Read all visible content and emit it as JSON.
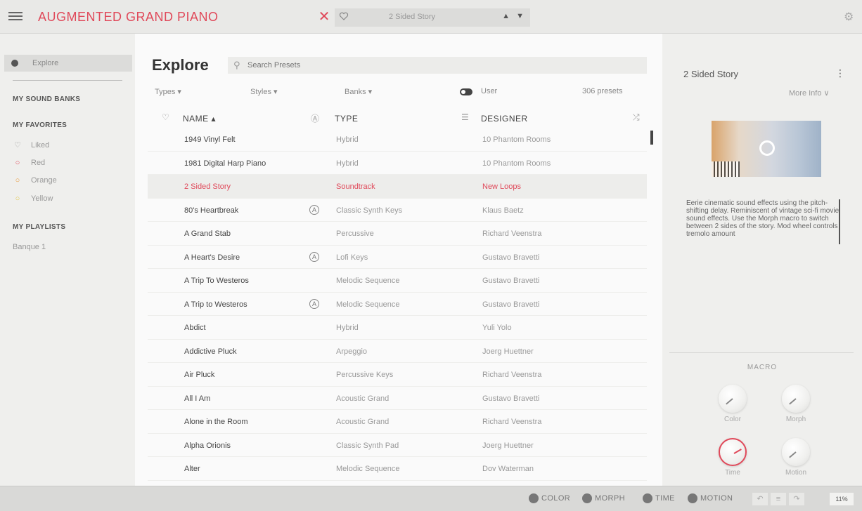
{
  "header": {
    "app_title": "AUGMENTED GRAND PIANO",
    "current_preset": "2 Sided Story",
    "nav_arrows": "▲ ▼"
  },
  "sidebar": {
    "explore_label": "Explore",
    "my_sound_banks": "MY SOUND BANKS",
    "my_favorites": "MY FAVORITES",
    "favorites": [
      {
        "label": "Liked",
        "icon": "heart-icon",
        "color": "#999999"
      },
      {
        "label": "Red",
        "icon": "circle-icon",
        "color": "#e0495a"
      },
      {
        "label": "Orange",
        "icon": "circle-icon",
        "color": "#e89a3c"
      },
      {
        "label": "Yellow",
        "icon": "circle-icon",
        "color": "#e3c74a"
      }
    ],
    "my_playlists": "MY PLAYLISTS",
    "playlists": [
      "Banque 1"
    ]
  },
  "explore": {
    "title": "Explore",
    "search_placeholder": "Search Presets",
    "filters": {
      "types": "Types ▾",
      "styles": "Styles ▾",
      "banks": "Banks ▾",
      "user": "User"
    },
    "preset_count": "306 presets",
    "columns": {
      "name": "NAME ▴",
      "type": "TYPE",
      "designer": "DESIGNER"
    },
    "rows": [
      {
        "name": "1949 Vinyl Felt",
        "type": "Hybrid",
        "designer": "10 Phantom Rooms",
        "arturia": false
      },
      {
        "name": "1981 Digital Harp Piano",
        "type": "Hybrid",
        "designer": "10 Phantom Rooms",
        "arturia": false
      },
      {
        "name": "2 Sided Story",
        "type": "Soundtrack",
        "designer": "New Loops",
        "arturia": false,
        "selected": true
      },
      {
        "name": "80's Heartbreak",
        "type": "Classic Synth Keys",
        "designer": "Klaus Baetz",
        "arturia": true
      },
      {
        "name": "A Grand Stab",
        "type": "Percussive",
        "designer": "Richard Veenstra",
        "arturia": false
      },
      {
        "name": "A Heart's Desire",
        "type": "Lofi Keys",
        "designer": "Gustavo Bravetti",
        "arturia": true
      },
      {
        "name": "A Trip To Westeros",
        "type": "Melodic Sequence",
        "designer": "Gustavo Bravetti",
        "arturia": false
      },
      {
        "name": "A Trip to Westeros",
        "type": "Melodic Sequence",
        "designer": "Gustavo Bravetti",
        "arturia": true
      },
      {
        "name": "Abdict",
        "type": "Hybrid",
        "designer": "Yuli Yolo",
        "arturia": false
      },
      {
        "name": "Addictive Pluck",
        "type": "Arpeggio",
        "designer": "Joerg Huettner",
        "arturia": false
      },
      {
        "name": "Air Pluck",
        "type": "Percussive Keys",
        "designer": "Richard Veenstra",
        "arturia": false
      },
      {
        "name": "All I Am",
        "type": "Acoustic Grand",
        "designer": "Gustavo Bravetti",
        "arturia": false
      },
      {
        "name": "Alone in the Room",
        "type": "Acoustic Grand",
        "designer": "Richard Veenstra",
        "arturia": false
      },
      {
        "name": "Alpha Orionis",
        "type": "Classic Synth Pad",
        "designer": "Joerg Huettner",
        "arturia": false
      },
      {
        "name": "Alter",
        "type": "Melodic Sequence",
        "designer": "Dov Waterman",
        "arturia": false
      }
    ]
  },
  "preset_info": {
    "title": "2 Sided Story",
    "more_info": "More Info ∨",
    "description": "Eerie cinematic sound effects using the pitch-shifting delay. Reminiscent of vintage sci-fi movie sound effects. Use the Morph macro to switch between 2 sides of the story. Mod wheel controls tremolo amount",
    "macro_label": "MACRO",
    "knobs": [
      {
        "label": "Color",
        "active": false
      },
      {
        "label": "Morph",
        "active": false
      },
      {
        "label": "Time",
        "active": true
      },
      {
        "label": "Motion",
        "active": false
      }
    ]
  },
  "bottom": {
    "macros": [
      "COLOR",
      "MORPH",
      "TIME",
      "MOTION"
    ],
    "zoom": "11%"
  },
  "colors": {
    "accent": "#e0495a"
  }
}
